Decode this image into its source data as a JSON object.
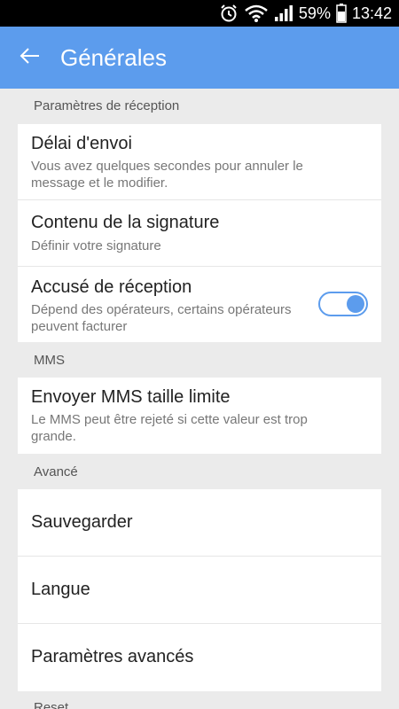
{
  "status": {
    "battery": "59%",
    "time": "13:42"
  },
  "app_bar": {
    "title": "Générales"
  },
  "sections": [
    {
      "header": "Paramètres de réception",
      "items": [
        {
          "title": "Délai d'envoi",
          "subtitle": "Vous avez quelques secondes pour annuler le message et le modifier."
        },
        {
          "title": "Contenu de la signature",
          "subtitle": "Définir votre signature"
        },
        {
          "title": "Accusé de réception",
          "subtitle": "Dépend des opérateurs, certains opérateurs peuvent facturer",
          "toggle_on": true
        }
      ]
    },
    {
      "header": "MMS",
      "items": [
        {
          "title": "Envoyer MMS taille limite",
          "subtitle": "Le MMS peut être rejeté si cette valeur est trop grande."
        }
      ]
    },
    {
      "header": "Avancé",
      "items": [
        {
          "title": "Sauvegarder"
        },
        {
          "title": "Langue"
        },
        {
          "title": "Paramètres avancés"
        }
      ]
    },
    {
      "header": "Reset"
    }
  ]
}
